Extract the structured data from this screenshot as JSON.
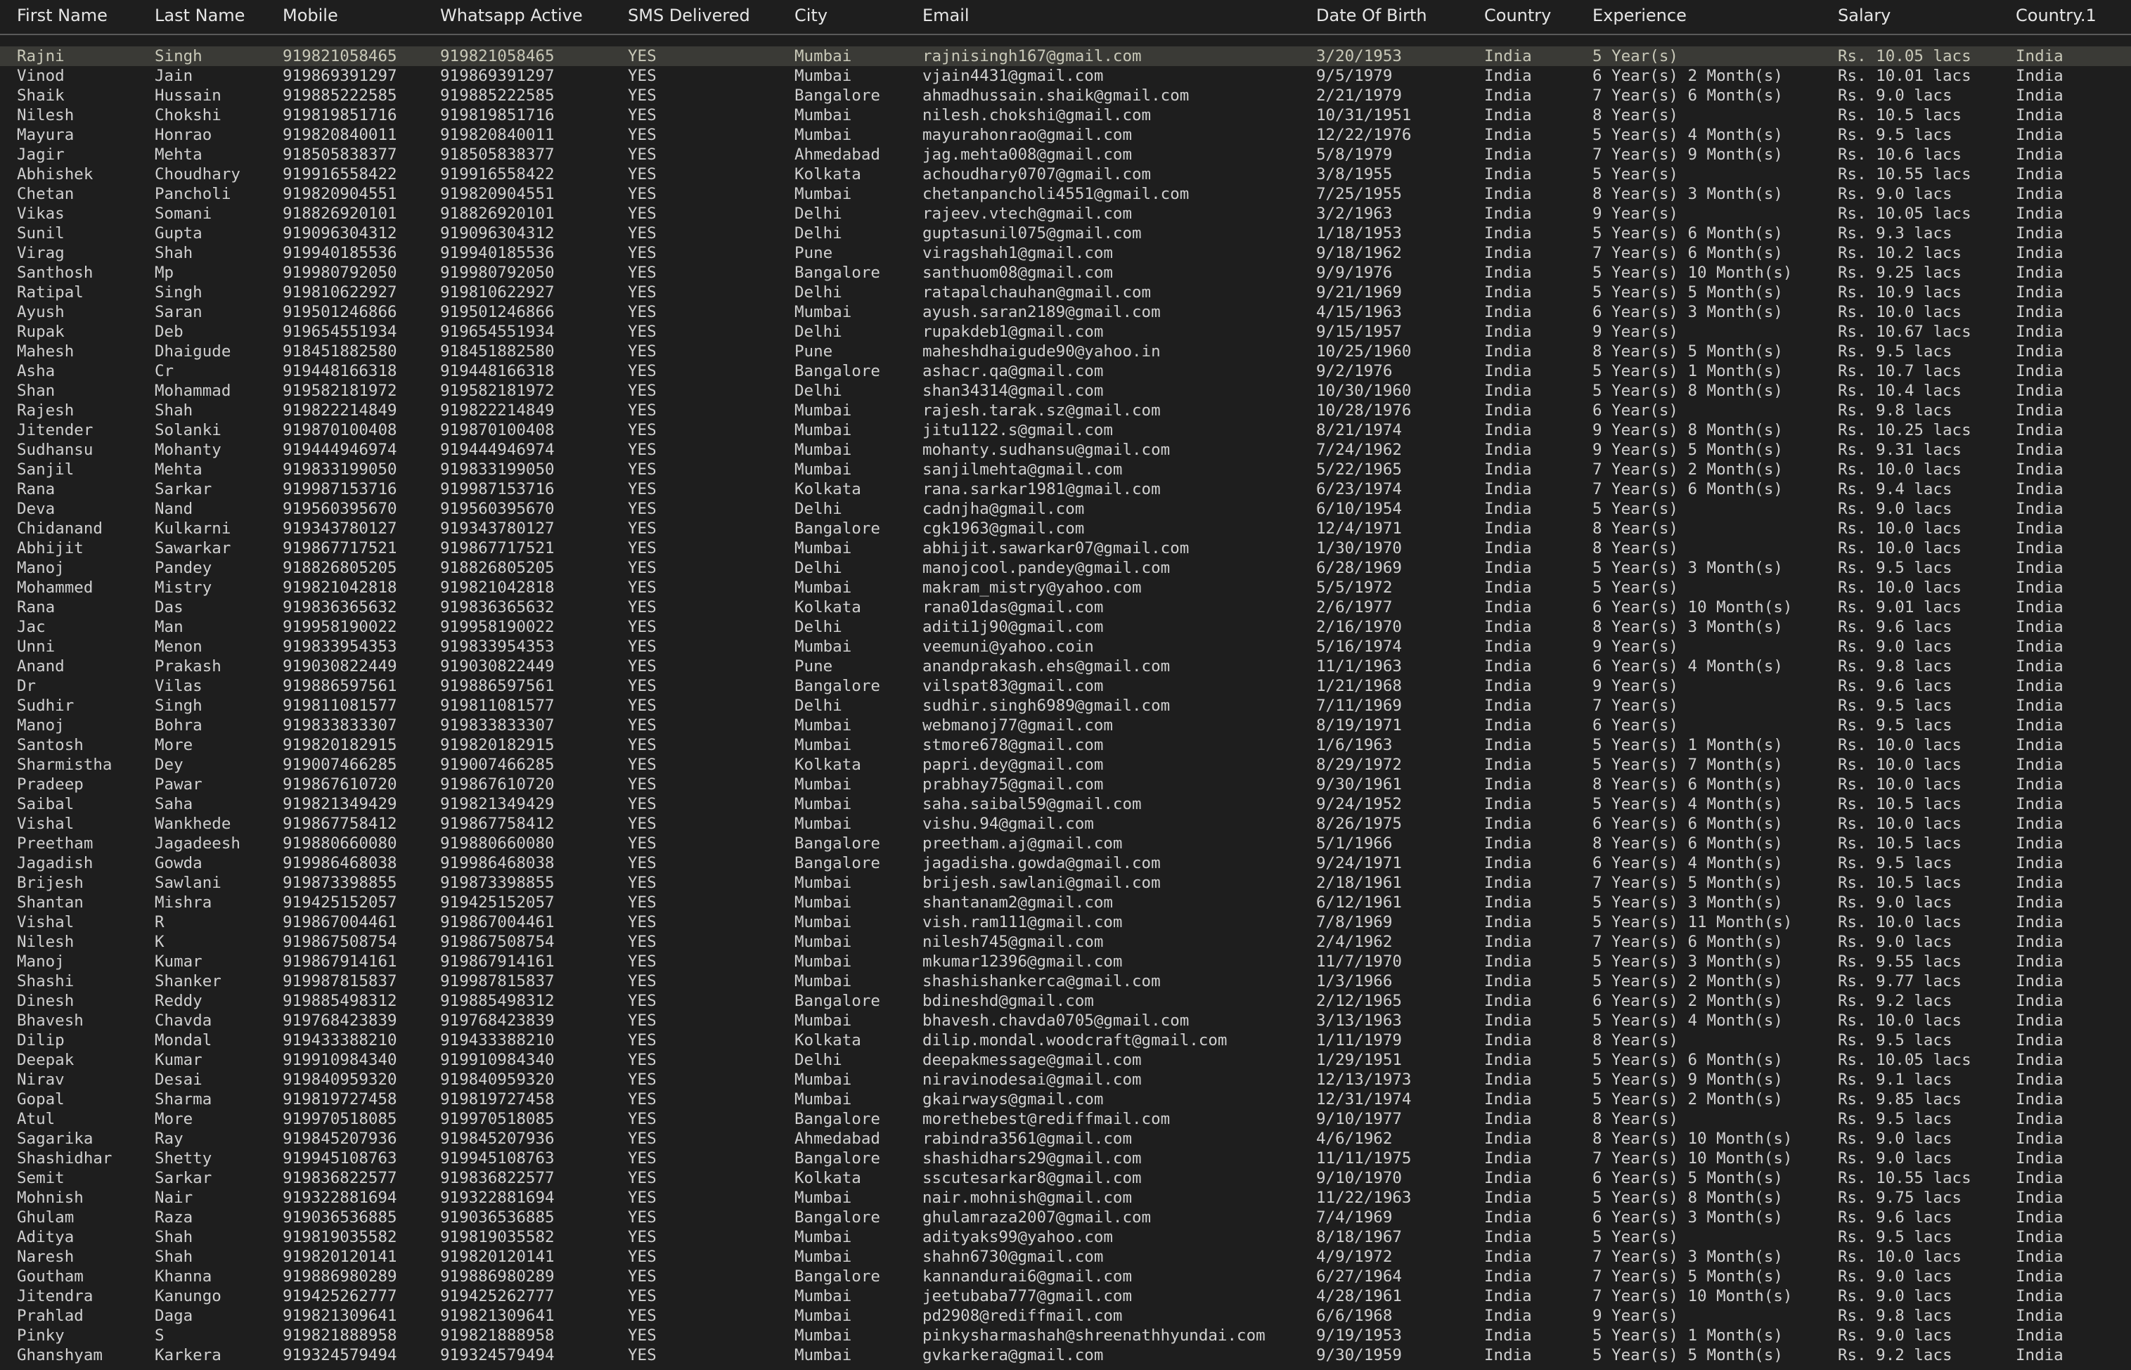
{
  "colors": {
    "background": "#1e1e1e",
    "text": "#d0d0d0",
    "header_text": "#e6e6e6",
    "header_rule": "#5a5a5a",
    "selected_row": "#3a3a36"
  },
  "table": {
    "columns": [
      "First Name",
      "Last Name",
      "Mobile",
      "Whatsapp Active",
      "SMS Delivered",
      "City",
      "Email",
      "Date Of Birth",
      "Country",
      "Experience",
      "Salary",
      "Country.1"
    ],
    "selected_row_index": 0,
    "rows": [
      [
        "Rajni",
        "Singh",
        "919821058465",
        "919821058465",
        "YES",
        "Mumbai",
        "rajnisingh167@gmail.com",
        "3/20/1953",
        "India",
        "5 Year(s)",
        "Rs. 10.05 lacs",
        "India"
      ],
      [
        "Vinod",
        "Jain",
        "919869391297",
        "919869391297",
        "YES",
        "Mumbai",
        "vjain4431@gmail.com",
        "9/5/1979",
        "India",
        "6 Year(s) 2 Month(s)",
        "Rs. 10.01 lacs",
        "India"
      ],
      [
        "Shaik",
        "Hussain",
        "919885222585",
        "919885222585",
        "YES",
        "Bangalore",
        "ahmadhussain.shaik@gmail.com",
        "2/21/1979",
        "India",
        "7 Year(s) 6 Month(s)",
        "Rs. 9.0 lacs",
        "India"
      ],
      [
        "Nilesh",
        "Chokshi",
        "919819851716",
        "919819851716",
        "YES",
        "Mumbai",
        "nilesh.chokshi@gmail.com",
        "10/31/1951",
        "India",
        "8 Year(s)",
        "Rs. 10.5 lacs",
        "India"
      ],
      [
        "Mayura",
        "Honrao",
        "919820840011",
        "919820840011",
        "YES",
        "Mumbai",
        "mayurahonrao@gmail.com",
        "12/22/1976",
        "India",
        "5 Year(s) 4 Month(s)",
        "Rs. 9.5 lacs",
        "India"
      ],
      [
        "Jagir",
        "Mehta",
        "918505838377",
        "918505838377",
        "YES",
        "Ahmedabad",
        "jag.mehta008@gmail.com",
        "5/8/1979",
        "India",
        "7 Year(s) 9 Month(s)",
        "Rs. 10.6 lacs",
        "India"
      ],
      [
        "Abhishek",
        "Choudhary",
        "919916558422",
        "919916558422",
        "YES",
        "Kolkata",
        "achoudhary0707@gmail.com",
        "3/8/1955",
        "India",
        "5 Year(s)",
        "Rs. 10.55 lacs",
        "India"
      ],
      [
        "Chetan",
        "Pancholi",
        "919820904551",
        "919820904551",
        "YES",
        "Mumbai",
        "chetanpancholi4551@gmail.com",
        "7/25/1955",
        "India",
        "8 Year(s) 3 Month(s)",
        "Rs. 9.0 lacs",
        "India"
      ],
      [
        "Vikas",
        "Somani",
        "918826920101",
        "918826920101",
        "YES",
        "Delhi",
        "rajeev.vtech@gmail.com",
        "3/2/1963",
        "India",
        "9 Year(s)",
        "Rs. 10.05 lacs",
        "India"
      ],
      [
        "Sunil",
        "Gupta",
        "919096304312",
        "919096304312",
        "YES",
        "Delhi",
        "guptasunil075@gmail.com",
        "1/18/1953",
        "India",
        "5 Year(s) 6 Month(s)",
        "Rs. 9.3 lacs",
        "India"
      ],
      [
        "Virag",
        "Shah",
        "919940185536",
        "919940185536",
        "YES",
        "Pune",
        "viragshah1@gmail.com",
        "9/18/1962",
        "India",
        "7 Year(s) 6 Month(s)",
        "Rs. 10.2 lacs",
        "India"
      ],
      [
        "Santhosh",
        "Mp",
        "919980792050",
        "919980792050",
        "YES",
        "Bangalore",
        "santhuom08@gmail.com",
        "9/9/1976",
        "India",
        "5 Year(s) 10 Month(s)",
        "Rs. 9.25 lacs",
        "India"
      ],
      [
        "Ratipal",
        "Singh",
        "919810622927",
        "919810622927",
        "YES",
        "Delhi",
        "ratapalchauhan@gmail.com",
        "9/21/1969",
        "India",
        "5 Year(s) 5 Month(s)",
        "Rs. 10.9 lacs",
        "India"
      ],
      [
        "Ayush",
        "Saran",
        "919501246866",
        "919501246866",
        "YES",
        "Mumbai",
        "ayush.saran2189@gmail.com",
        "4/15/1963",
        "India",
        "6 Year(s) 3 Month(s)",
        "Rs. 10.0 lacs",
        "India"
      ],
      [
        "Rupak",
        "Deb",
        "919654551934",
        "919654551934",
        "YES",
        "Delhi",
        "rupakdeb1@gmail.com",
        "9/15/1957",
        "India",
        "9 Year(s)",
        "Rs. 10.67 lacs",
        "India"
      ],
      [
        "Mahesh",
        "Dhaigude",
        "918451882580",
        "918451882580",
        "YES",
        "Pune",
        "maheshdhaigude90@yahoo.in",
        "10/25/1960",
        "India",
        "8 Year(s) 5 Month(s)",
        "Rs. 9.5 lacs",
        "India"
      ],
      [
        "Asha",
        "Cr",
        "919448166318",
        "919448166318",
        "YES",
        "Bangalore",
        "ashacr.qa@gmail.com",
        "9/2/1976",
        "India",
        "5 Year(s) 1 Month(s)",
        "Rs. 10.7 lacs",
        "India"
      ],
      [
        "Shan",
        "Mohammad",
        "919582181972",
        "919582181972",
        "YES",
        "Delhi",
        "shan34314@gmail.com",
        "10/30/1960",
        "India",
        "5 Year(s) 8 Month(s)",
        "Rs. 10.4 lacs",
        "India"
      ],
      [
        "Rajesh",
        "Shah",
        "919822214849",
        "919822214849",
        "YES",
        "Mumbai",
        "rajesh.tarak.sz@gmail.com",
        "10/28/1976",
        "India",
        "6 Year(s)",
        "Rs. 9.8 lacs",
        "India"
      ],
      [
        "Jitender",
        "Solanki",
        "919870100408",
        "919870100408",
        "YES",
        "Mumbai",
        "jitu1122.s@gmail.com",
        "8/21/1974",
        "India",
        "9 Year(s) 8 Month(s)",
        "Rs. 10.25 lacs",
        "India"
      ],
      [
        "Sudhansu",
        "Mohanty",
        "919444946974",
        "919444946974",
        "YES",
        "Mumbai",
        "mohanty.sudhansu@gmail.com",
        "7/24/1962",
        "India",
        "9 Year(s) 5 Month(s)",
        "Rs. 9.31 lacs",
        "India"
      ],
      [
        "Sanjil",
        "Mehta",
        "919833199050",
        "919833199050",
        "YES",
        "Mumbai",
        "sanjilmehta@gmail.com",
        "5/22/1965",
        "India",
        "7 Year(s) 2 Month(s)",
        "Rs. 10.0 lacs",
        "India"
      ],
      [
        "Rana",
        "Sarkar",
        "919987153716",
        "919987153716",
        "YES",
        "Kolkata",
        "rana.sarkar1981@gmail.com",
        "6/23/1974",
        "India",
        "7 Year(s) 6 Month(s)",
        "Rs. 9.4 lacs",
        "India"
      ],
      [
        "Deva",
        "Nand",
        "919560395670",
        "919560395670",
        "YES",
        "Delhi",
        "cadnjha@gmail.com",
        "6/10/1954",
        "India",
        "5 Year(s)",
        "Rs. 9.0 lacs",
        "India"
      ],
      [
        "Chidanand",
        "Kulkarni",
        "919343780127",
        "919343780127",
        "YES",
        "Bangalore",
        "cgk1963@gmail.com",
        "12/4/1971",
        "India",
        "8 Year(s)",
        "Rs. 10.0 lacs",
        "India"
      ],
      [
        "Abhijit",
        "Sawarkar",
        "919867717521",
        "919867717521",
        "YES",
        "Mumbai",
        "abhijit.sawarkar07@gmail.com",
        "1/30/1970",
        "India",
        "8 Year(s)",
        "Rs. 10.0 lacs",
        "India"
      ],
      [
        "Manoj",
        "Pandey",
        "918826805205",
        "918826805205",
        "YES",
        "Delhi",
        "manojcool.pandey@gmail.com",
        "6/28/1969",
        "India",
        "5 Year(s) 3 Month(s)",
        "Rs. 9.5 lacs",
        "India"
      ],
      [
        "Mohammed",
        "Mistry",
        "919821042818",
        "919821042818",
        "YES",
        "Mumbai",
        "makram_mistry@yahoo.com",
        "5/5/1972",
        "India",
        "5 Year(s)",
        "Rs. 10.0 lacs",
        "India"
      ],
      [
        "Rana",
        "Das",
        "919836365632",
        "919836365632",
        "YES",
        "Kolkata",
        "rana01das@gmail.com",
        "2/6/1977",
        "India",
        "6 Year(s) 10 Month(s)",
        "Rs. 9.01 lacs",
        "India"
      ],
      [
        "Jac",
        "Man",
        "919958190022",
        "919958190022",
        "YES",
        "Delhi",
        "aditi1j90@gmail.com",
        "2/16/1970",
        "India",
        "8 Year(s) 3 Month(s)",
        "Rs. 9.6 lacs",
        "India"
      ],
      [
        "Unni",
        "Menon",
        "919833954353",
        "919833954353",
        "YES",
        "Mumbai",
        "veemuni@yahoo.coin",
        "5/16/1974",
        "India",
        "9 Year(s)",
        "Rs. 9.0 lacs",
        "India"
      ],
      [
        "Anand",
        "Prakash",
        "919030822449",
        "919030822449",
        "YES",
        "Pune",
        "anandprakash.ehs@gmail.com",
        "11/1/1963",
        "India",
        "6 Year(s) 4 Month(s)",
        "Rs. 9.8 lacs",
        "India"
      ],
      [
        "Dr",
        "Vilas",
        "919886597561",
        "919886597561",
        "YES",
        "Bangalore",
        "vilspat83@gmail.com",
        "1/21/1968",
        "India",
        "9 Year(s)",
        "Rs. 9.6 lacs",
        "India"
      ],
      [
        "Sudhir",
        "Singh",
        "919811081577",
        "919811081577",
        "YES",
        "Delhi",
        "sudhir.singh6989@gmail.com",
        "7/11/1969",
        "India",
        "7 Year(s)",
        "Rs. 9.5 lacs",
        "India"
      ],
      [
        "Manoj",
        "Bohra",
        "919833833307",
        "919833833307",
        "YES",
        "Mumbai",
        "webmanoj77@gmail.com",
        "8/19/1971",
        "India",
        "6 Year(s)",
        "Rs. 9.5 lacs",
        "India"
      ],
      [
        "Santosh",
        "More",
        "919820182915",
        "919820182915",
        "YES",
        "Mumbai",
        "stmore678@gmail.com",
        "1/6/1963",
        "India",
        "5 Year(s) 1 Month(s)",
        "Rs. 10.0 lacs",
        "India"
      ],
      [
        "Sharmistha",
        "Dey",
        "919007466285",
        "919007466285",
        "YES",
        "Kolkata",
        "papri.dey@gmail.com",
        "8/29/1972",
        "India",
        "5 Year(s) 7 Month(s)",
        "Rs. 10.0 lacs",
        "India"
      ],
      [
        "Pradeep",
        "Pawar",
        "919867610720",
        "919867610720",
        "YES",
        "Mumbai",
        "prabhay75@gmail.com",
        "9/30/1961",
        "India",
        "8 Year(s) 6 Month(s)",
        "Rs. 10.0 lacs",
        "India"
      ],
      [
        "Saibal",
        "Saha",
        "919821349429",
        "919821349429",
        "YES",
        "Mumbai",
        "saha.saibal59@gmail.com",
        "9/24/1952",
        "India",
        "5 Year(s) 4 Month(s)",
        "Rs. 10.5 lacs",
        "India"
      ],
      [
        "Vishal",
        "Wankhede",
        "919867758412",
        "919867758412",
        "YES",
        "Mumbai",
        "vishu.94@gmail.com",
        "8/26/1975",
        "India",
        "6 Year(s) 6 Month(s)",
        "Rs. 10.0 lacs",
        "India"
      ],
      [
        "Preetham",
        "Jagadeesh",
        "919880660080",
        "919880660080",
        "YES",
        "Bangalore",
        "preetham.aj@gmail.com",
        "5/1/1966",
        "India",
        "8 Year(s) 6 Month(s)",
        "Rs. 10.5 lacs",
        "India"
      ],
      [
        "Jagadish",
        "Gowda",
        "919986468038",
        "919986468038",
        "YES",
        "Bangalore",
        "jagadisha.gowda@gmail.com",
        "9/24/1971",
        "India",
        "6 Year(s) 4 Month(s)",
        "Rs. 9.5 lacs",
        "India"
      ],
      [
        "Brijesh",
        "Sawlani",
        "919873398855",
        "919873398855",
        "YES",
        "Mumbai",
        "brijesh.sawlani@gmail.com",
        "2/18/1961",
        "India",
        "7 Year(s) 5 Month(s)",
        "Rs. 10.5 lacs",
        "India"
      ],
      [
        "Shantan",
        "Mishra",
        "919425152057",
        "919425152057",
        "YES",
        "Mumbai",
        "shantanam2@gmail.com",
        "6/12/1961",
        "India",
        "5 Year(s) 3 Month(s)",
        "Rs. 9.0 lacs",
        "India"
      ],
      [
        "Vishal",
        "R",
        "919867004461",
        "919867004461",
        "YES",
        "Mumbai",
        "vish.ram111@gmail.com",
        "7/8/1969",
        "India",
        "5 Year(s) 11 Month(s)",
        "Rs. 10.0 lacs",
        "India"
      ],
      [
        "Nilesh",
        "K",
        "919867508754",
        "919867508754",
        "YES",
        "Mumbai",
        "nilesh745@gmail.com",
        "2/4/1962",
        "India",
        "7 Year(s) 6 Month(s)",
        "Rs. 9.0 lacs",
        "India"
      ],
      [
        "Manoj",
        "Kumar",
        "919867914161",
        "919867914161",
        "YES",
        "Mumbai",
        "mkumar12396@gmail.com",
        "11/7/1970",
        "India",
        "5 Year(s) 3 Month(s)",
        "Rs. 9.55 lacs",
        "India"
      ],
      [
        "Shashi",
        "Shanker",
        "919987815837",
        "919987815837",
        "YES",
        "Mumbai",
        "shashishankerca@gmail.com",
        "1/3/1966",
        "India",
        "5 Year(s) 2 Month(s)",
        "Rs. 9.77 lacs",
        "India"
      ],
      [
        "Dinesh",
        "Reddy",
        "919885498312",
        "919885498312",
        "YES",
        "Bangalore",
        "bdineshd@gmail.com",
        "2/12/1965",
        "India",
        "6 Year(s) 2 Month(s)",
        "Rs. 9.2 lacs",
        "India"
      ],
      [
        "Bhavesh",
        "Chavda",
        "919768423839",
        "919768423839",
        "YES",
        "Mumbai",
        "bhavesh.chavda0705@gmail.com",
        "3/13/1963",
        "India",
        "5 Year(s) 4 Month(s)",
        "Rs. 10.0 lacs",
        "India"
      ],
      [
        "Dilip",
        "Mondal",
        "919433388210",
        "919433388210",
        "YES",
        "Kolkata",
        "dilip.mondal.woodcraft@gmail.com",
        "1/11/1979",
        "India",
        "8 Year(s)",
        "Rs. 9.5 lacs",
        "India"
      ],
      [
        "Deepak",
        "Kumar",
        "919910984340",
        "919910984340",
        "YES",
        "Delhi",
        "deepakmessage@gmail.com",
        "1/29/1951",
        "India",
        "5 Year(s) 6 Month(s)",
        "Rs. 10.05 lacs",
        "India"
      ],
      [
        "Nirav",
        "Desai",
        "919840959320",
        "919840959320",
        "YES",
        "Mumbai",
        "niravinodesai@gmail.com",
        "12/13/1973",
        "India",
        "5 Year(s) 9 Month(s)",
        "Rs. 9.1 lacs",
        "India"
      ],
      [
        "Gopal",
        "Sharma",
        "919819727458",
        "919819727458",
        "YES",
        "Mumbai",
        "gkairways@gmail.com",
        "12/31/1974",
        "India",
        "5 Year(s) 2 Month(s)",
        "Rs. 9.85 lacs",
        "India"
      ],
      [
        "Atul",
        "More",
        "919970518085",
        "919970518085",
        "YES",
        "Bangalore",
        "morethebest@rediffmail.com",
        "9/10/1977",
        "India",
        "8 Year(s)",
        "Rs. 9.5 lacs",
        "India"
      ],
      [
        "Sagarika",
        "Ray",
        "919845207936",
        "919845207936",
        "YES",
        "Ahmedabad",
        "rabindra3561@gmail.com",
        "4/6/1962",
        "India",
        "8 Year(s) 10 Month(s)",
        "Rs. 9.0 lacs",
        "India"
      ],
      [
        "Shashidhar",
        "Shetty",
        "919945108763",
        "919945108763",
        "YES",
        "Bangalore",
        "shashidhars29@gmail.com",
        "11/11/1975",
        "India",
        "7 Year(s) 10 Month(s)",
        "Rs. 9.0 lacs",
        "India"
      ],
      [
        "Semit",
        "Sarkar",
        "919836822577",
        "919836822577",
        "YES",
        "Kolkata",
        "sscutesarkar8@gmail.com",
        "9/10/1970",
        "India",
        "6 Year(s) 5 Month(s)",
        "Rs. 10.55 lacs",
        "India"
      ],
      [
        "Mohnish",
        "Nair",
        "919322881694",
        "919322881694",
        "YES",
        "Mumbai",
        "nair.mohnish@gmail.com",
        "11/22/1963",
        "India",
        "5 Year(s) 8 Month(s)",
        "Rs. 9.75 lacs",
        "India"
      ],
      [
        "Ghulam",
        "Raza",
        "919036536885",
        "919036536885",
        "YES",
        "Bangalore",
        "ghulamraza2007@gmail.com",
        "7/4/1969",
        "India",
        "6 Year(s) 3 Month(s)",
        "Rs. 9.6 lacs",
        "India"
      ],
      [
        "Aditya",
        "Shah",
        "919819035582",
        "919819035582",
        "YES",
        "Mumbai",
        "adityaks99@yahoo.com",
        "8/18/1967",
        "India",
        "5 Year(s)",
        "Rs. 9.5 lacs",
        "India"
      ],
      [
        "Naresh",
        "Shah",
        "919820120141",
        "919820120141",
        "YES",
        "Mumbai",
        "shahn6730@gmail.com",
        "4/9/1972",
        "India",
        "7 Year(s) 3 Month(s)",
        "Rs. 10.0 lacs",
        "India"
      ],
      [
        "Goutham",
        "Khanna",
        "919886980289",
        "919886980289",
        "YES",
        "Bangalore",
        "kannandurai6@gmail.com",
        "6/27/1964",
        "India",
        "7 Year(s) 5 Month(s)",
        "Rs. 9.0 lacs",
        "India"
      ],
      [
        "Jitendra",
        "Kanungo",
        "919425262777",
        "919425262777",
        "YES",
        "Mumbai",
        "jeetubaba777@gmail.com",
        "4/28/1961",
        "India",
        "7 Year(s) 10 Month(s)",
        "Rs. 9.0 lacs",
        "India"
      ],
      [
        "Prahlad",
        "Daga",
        "919821309641",
        "919821309641",
        "YES",
        "Mumbai",
        "pd2908@rediffmail.com",
        "6/6/1968",
        "India",
        "9 Year(s)",
        "Rs. 9.8 lacs",
        "India"
      ],
      [
        "Pinky",
        "S",
        "919821888958",
        "919821888958",
        "YES",
        "Mumbai",
        "pinkysharmashah@shreenathhyundai.com",
        "9/19/1953",
        "India",
        "5 Year(s) 1 Month(s)",
        "Rs. 9.0 lacs",
        "India"
      ],
      [
        "Ghanshyam",
        "Karkera",
        "919324579494",
        "919324579494",
        "YES",
        "Mumbai",
        "gvkarkera@gmail.com",
        "9/30/1959",
        "India",
        "5 Year(s) 5 Month(s)",
        "Rs. 9.2 lacs",
        "India"
      ]
    ]
  }
}
